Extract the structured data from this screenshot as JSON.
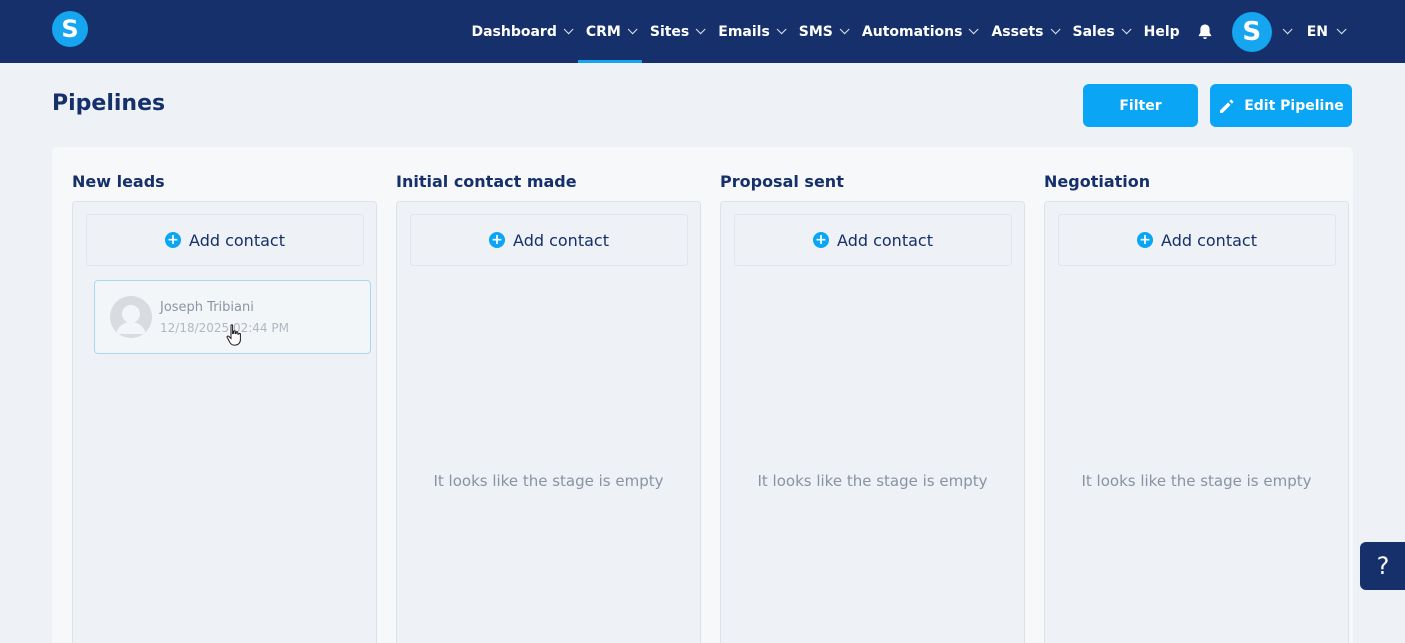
{
  "nav": {
    "items": [
      {
        "label": "Dashboard",
        "has_dropdown": true,
        "active": false
      },
      {
        "label": "CRM",
        "has_dropdown": true,
        "active": true
      },
      {
        "label": "Sites",
        "has_dropdown": true,
        "active": false
      },
      {
        "label": "Emails",
        "has_dropdown": true,
        "active": false
      },
      {
        "label": "SMS",
        "has_dropdown": true,
        "active": false
      },
      {
        "label": "Automations",
        "has_dropdown": true,
        "active": false
      },
      {
        "label": "Assets",
        "has_dropdown": true,
        "active": false
      },
      {
        "label": "Sales",
        "has_dropdown": true,
        "active": false
      },
      {
        "label": "Help",
        "has_dropdown": false,
        "active": false
      }
    ],
    "logo_letter": "S",
    "avatar_letter": "S",
    "language": "EN",
    "bell_icon": "bell-icon"
  },
  "page": {
    "title": "Pipelines",
    "filter_label": "Filter",
    "edit_label": "Edit Pipeline"
  },
  "stages": [
    {
      "title": "New leads",
      "add_label": "Add contact",
      "empty_text": ""
    },
    {
      "title": "Initial contact made",
      "add_label": "Add contact",
      "empty_text": "It looks like the stage is empty"
    },
    {
      "title": "Proposal sent",
      "add_label": "Add contact",
      "empty_text": "It looks like the stage is empty"
    },
    {
      "title": "Negotiation",
      "add_label": "Add contact",
      "empty_text": "It looks like the stage is empty"
    }
  ],
  "contact": {
    "name": "Joseph Tribiani",
    "date": "12/18/2025 02:44 PM"
  },
  "help_label": "?",
  "colors": {
    "nav_bg": "#15306b",
    "accent": "#0aa5f5",
    "page_bg": "#eef1f5"
  }
}
